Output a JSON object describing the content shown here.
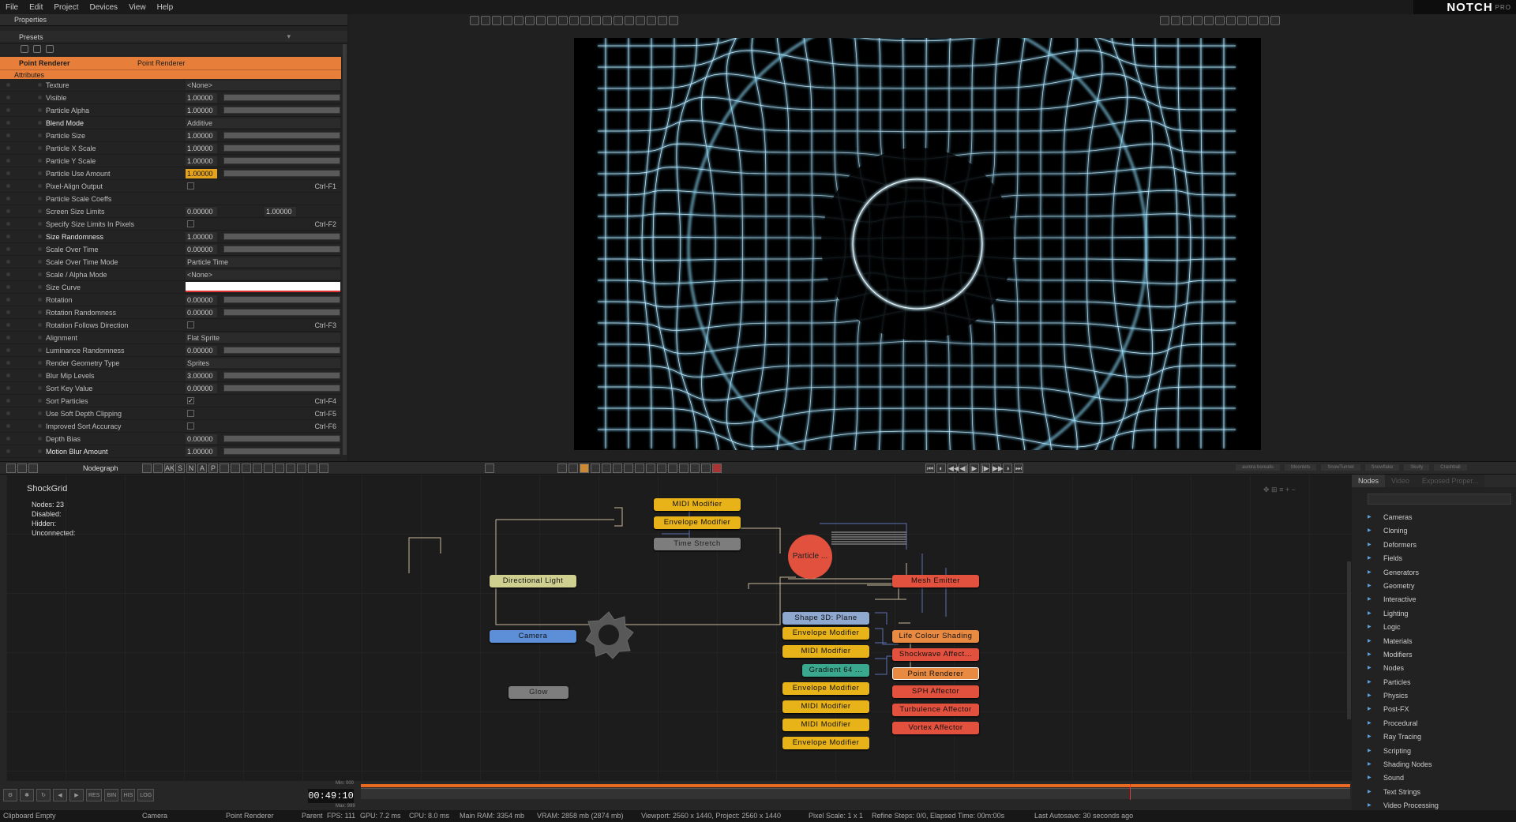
{
  "menu": [
    "File",
    "Edit",
    "Project",
    "Devices",
    "View",
    "Help"
  ],
  "logo": {
    "name": "NOTCH",
    "edition": "PRO"
  },
  "properties": {
    "title": "Properties",
    "presets_label": "Presets",
    "node_name": "Point Renderer",
    "node_type": "Point Renderer",
    "section": "Attributes",
    "rows": [
      {
        "label": "Texture",
        "kind": "select",
        "value": "<None>"
      },
      {
        "label": "Visible",
        "kind": "num",
        "value": "1.00000"
      },
      {
        "label": "Particle Alpha",
        "kind": "num",
        "value": "1.00000"
      },
      {
        "label": "Blend Mode",
        "kind": "select",
        "value": "Additive",
        "hl": true
      },
      {
        "label": "Particle Size",
        "kind": "num",
        "value": "1.00000"
      },
      {
        "label": "Particle X Scale",
        "kind": "num",
        "value": "1.00000"
      },
      {
        "label": "Particle Y Scale",
        "kind": "num",
        "value": "1.00000"
      },
      {
        "label": "Particle Use Amount",
        "kind": "num",
        "value": "1.00000",
        "orange": true
      },
      {
        "label": "Pixel-Align Output",
        "kind": "check",
        "value": "",
        "shortcut": "Ctrl-F1"
      },
      {
        "label": "Particle Scale Coeffs",
        "kind": "empty",
        "value": ""
      },
      {
        "label": "Screen Size Limits",
        "kind": "num2",
        "value": "0.00000",
        "value2": "1.00000"
      },
      {
        "label": "Specify Size Limits In Pixels",
        "kind": "check",
        "value": "",
        "shortcut": "Ctrl-F2"
      },
      {
        "label": "Size Randomness",
        "kind": "num",
        "value": "1.00000",
        "hl": true
      },
      {
        "label": "Scale Over Time",
        "kind": "num",
        "value": "0.00000"
      },
      {
        "label": "Scale Over Time Mode",
        "kind": "select",
        "value": "Particle Time"
      },
      {
        "label": "Scale / Alpha Mode",
        "kind": "select",
        "value": "<None>"
      },
      {
        "label": "Size Curve",
        "kind": "curve",
        "value": ""
      },
      {
        "label": "Rotation",
        "kind": "num",
        "value": "0.00000"
      },
      {
        "label": "Rotation Randomness",
        "kind": "num",
        "value": "0.00000"
      },
      {
        "label": "Rotation Follows Direction",
        "kind": "check",
        "value": "",
        "shortcut": "Ctrl-F3"
      },
      {
        "label": "Alignment",
        "kind": "select",
        "value": "Flat Sprite"
      },
      {
        "label": "Luminance Randomness",
        "kind": "num",
        "value": "0.00000"
      },
      {
        "label": "Render Geometry Type",
        "kind": "select",
        "value": "Sprites"
      },
      {
        "label": "Blur Mip Levels",
        "kind": "num",
        "value": "3.00000"
      },
      {
        "label": "Sort Key Value",
        "kind": "num",
        "value": "0.00000"
      },
      {
        "label": "Sort Particles",
        "kind": "check",
        "value": "✓",
        "shortcut": "Ctrl-F4"
      },
      {
        "label": "Use Soft Depth Clipping",
        "kind": "check",
        "value": "",
        "shortcut": "Ctrl-F5"
      },
      {
        "label": "Improved Sort Accuracy",
        "kind": "check",
        "value": "",
        "shortcut": "Ctrl-F6"
      },
      {
        "label": "Depth Bias",
        "kind": "num",
        "value": "0.00000"
      },
      {
        "label": "Motion Blur Amount",
        "kind": "num",
        "value": "1.00000",
        "hl": true
      }
    ]
  },
  "nodegraph": {
    "tab": "Nodegraph",
    "toolbar_letters": [
      "AK",
      "S",
      "N",
      "A",
      "P"
    ],
    "title": "ShockGrid",
    "stats": [
      "Nodes:  23",
      "Disabled:",
      "Hidden:",
      "Unconnected:"
    ],
    "nodes": {
      "midi1": "MIDI  Modifier",
      "env1": "Envelope  Modifier",
      "timestretch": "Time  Stretch",
      "particle": "Particle ...",
      "dirlight": "Directional  Light",
      "camera": "Camera",
      "glow": "Glow",
      "mesh": "Mesh  Emitter",
      "shape": "Shape  3D:  Plane",
      "env2": "Envelope  Modifier",
      "midi2": "MIDI  Modifier",
      "gradient": "Gradient  64 ...",
      "env3": "Envelope  Modifier",
      "midi3": "MIDI  Modifier",
      "midi4": "MIDI  Modifier",
      "env4": "Envelope  Modifier",
      "lifecolour": "Life  Colour  Shading",
      "shockwave": "Shockwave  Affect...",
      "pointrenderer": "Point  Renderer",
      "sph": "SPH  Affector",
      "turbulence": "Turbulence  Affector",
      "vortex": "Vortex  Affector"
    }
  },
  "library": {
    "tabs": [
      "Nodes",
      "Video",
      "Exposed Proper..."
    ],
    "items": [
      "Cameras",
      "Cloning",
      "Deformers",
      "Fields",
      "Generators",
      "Geometry",
      "Interactive",
      "Lighting",
      "Logic",
      "Materials",
      "Modifiers",
      "Nodes",
      "Particles",
      "Physics",
      "Post-FX",
      "Procedural",
      "Ray Tracing",
      "Scripting",
      "Shading Nodes",
      "Sound",
      "Text Strings",
      "Video Processing"
    ]
  },
  "layer_tabs": [
    "aurora borealis",
    "Moonlets",
    "SnowTunnel",
    "Snowflake",
    "Skully",
    "Crashball"
  ],
  "timeline": {
    "timecode": "00:49:10",
    "min": "Min: 000",
    "max": "Max: 999",
    "buttons": [
      "RES",
      "BIN",
      "HIS",
      "LOG"
    ]
  },
  "status": {
    "clipboard": "Clipboard Empty",
    "camera": "Camera",
    "selected": "Point Renderer",
    "parent": "Parent",
    "fps": "FPS: 111",
    "gpu": "GPU: 7.2 ms",
    "cpu": "CPU: 8.0 ms",
    "ram": "Main RAM: 3354 mb",
    "vram": "VRAM: 2858 mb (2874 mb)",
    "viewport": "Viewport: 2560 x 1440, Project: 2560 x 1440",
    "pixelscale": "Pixel Scale: 1 x 1",
    "refine": "Refine Steps: 0/0, Elapsed Time: 00m:00s",
    "autosave": "Last Autosave: 30 seconds ago"
  }
}
